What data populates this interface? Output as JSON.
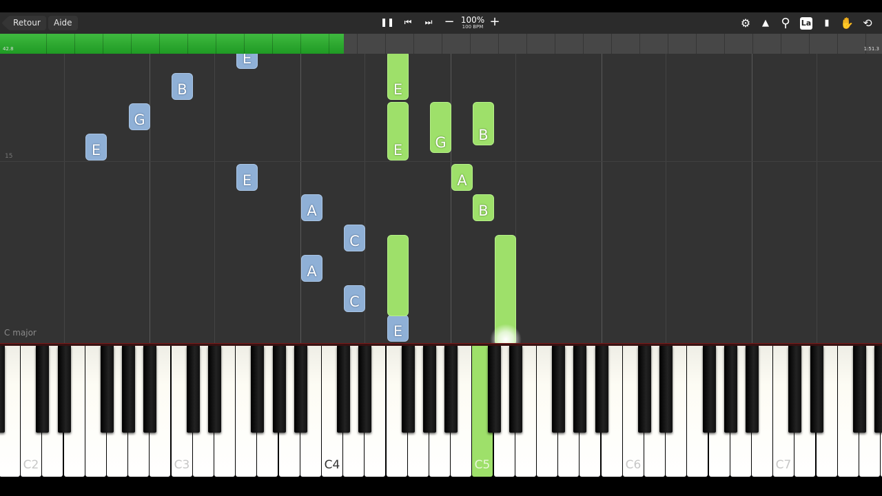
{
  "toolbar": {
    "back_label": "Retour",
    "help_label": "Aide",
    "pause_icon": "❚❚",
    "prev_icon": "⏮",
    "next_icon": "⏭",
    "minus_icon": "−",
    "plus_icon": "+",
    "speed_percent": "100%",
    "speed_bpm": "100 BPM",
    "settings_icon": "⚙",
    "metronome_icon": "▲",
    "zoom_icon": "⚲",
    "note_label_button": "La",
    "bookmark_icon": "▮",
    "hand_icon": "✋",
    "loop_icon": "⟲"
  },
  "timeline": {
    "elapsed": "42.8",
    "total": "1:51.3",
    "progress": 0.39
  },
  "roll": {
    "measure_number": "15",
    "key_signature": "C major"
  },
  "colors": {
    "played_note": "#9ee06a",
    "upcoming_note": "#8fb0d6",
    "progress_bar": "#2fb032"
  },
  "notes": [
    {
      "label": "E",
      "color": "blue"
    },
    {
      "label": "B",
      "color": "blue"
    },
    {
      "label": "G",
      "color": "blue"
    },
    {
      "label": "E",
      "color": "blue"
    },
    {
      "label": "E",
      "color": "blue"
    },
    {
      "label": "A",
      "color": "blue"
    },
    {
      "label": "C",
      "color": "blue"
    },
    {
      "label": "A",
      "color": "blue"
    },
    {
      "label": "C",
      "color": "blue"
    },
    {
      "label": "E",
      "color": "blue"
    },
    {
      "label": "E",
      "color": "green"
    },
    {
      "label": "E",
      "color": "green"
    },
    {
      "label": "G",
      "color": "green"
    },
    {
      "label": "B",
      "color": "green"
    },
    {
      "label": "A",
      "color": "green"
    },
    {
      "label": "B",
      "color": "green"
    },
    {
      "label": "",
      "color": "green"
    },
    {
      "label": "",
      "color": "green"
    }
  ],
  "keyboard": {
    "octave_labels": [
      "C2",
      "C3",
      "C4",
      "C5",
      "C6",
      "C7"
    ],
    "active_key": "C5"
  }
}
